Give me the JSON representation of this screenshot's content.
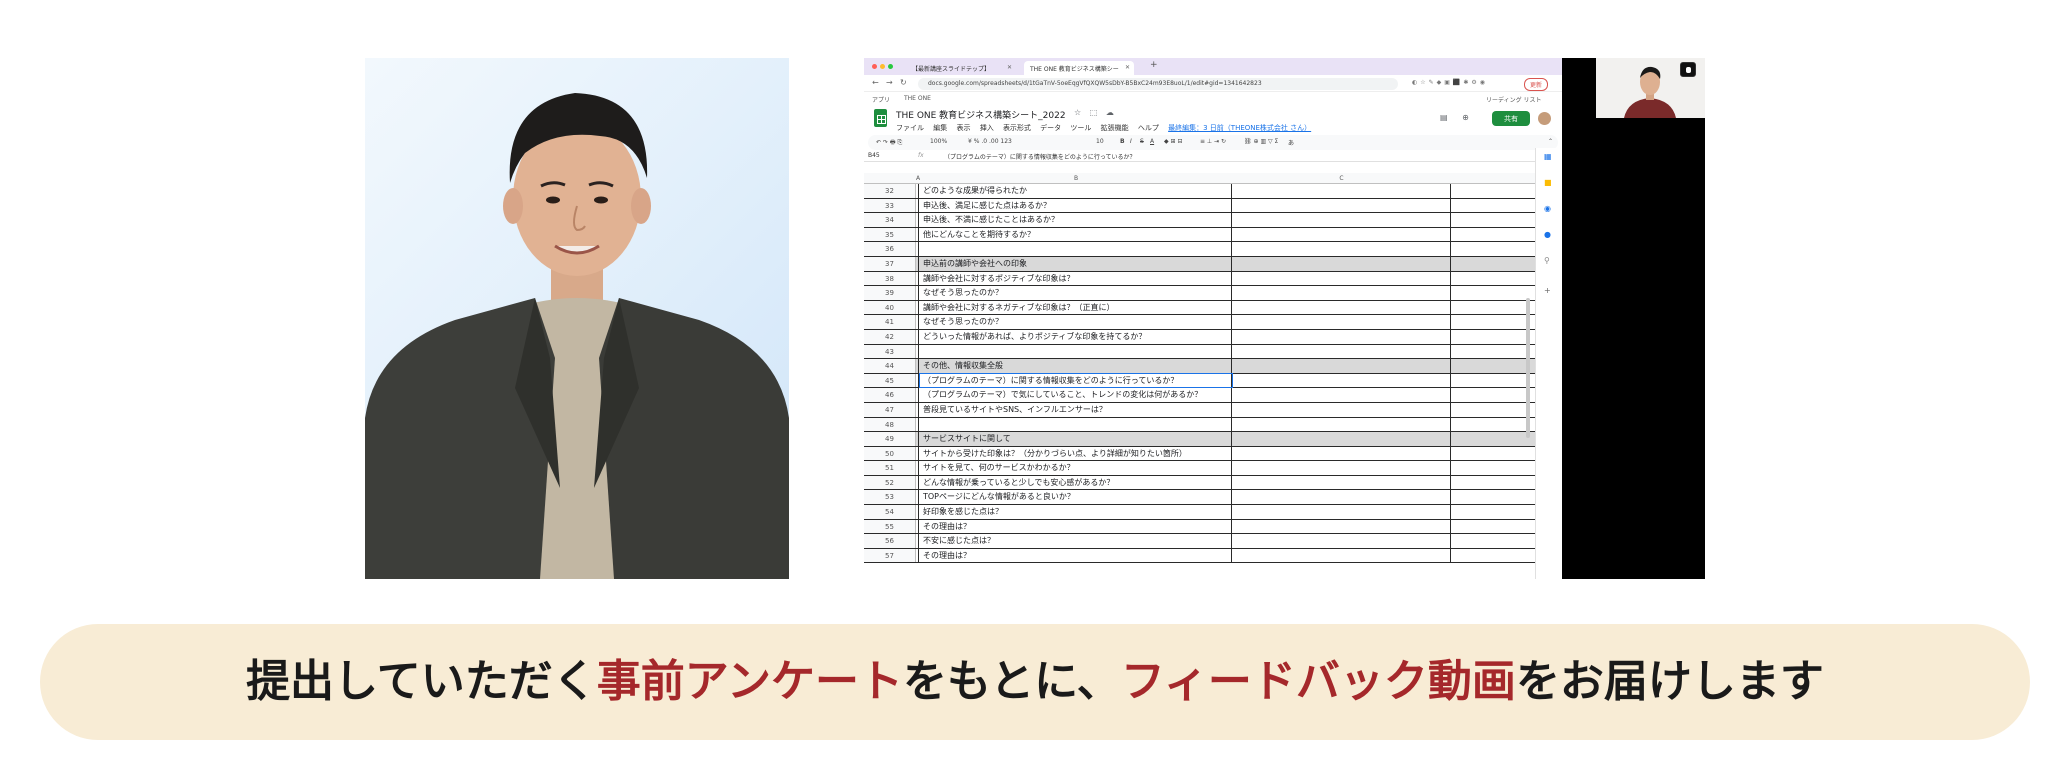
{
  "caption": {
    "part1": "提出していただく",
    "highlight1": "事前アンケート",
    "part2": "をもとに、",
    "highlight2": "フィードバック動画",
    "part3": "をお届けします",
    "highlight_color": "#a5282b",
    "banner_color": "#f8ecd5"
  },
  "browser": {
    "tabs": [
      {
        "label": "【最新講座スライドテップ】",
        "active": false
      },
      {
        "label": "THE ONE 教育ビジネス構築シー",
        "active": true
      }
    ],
    "url": "docs.google.com/spreadsheets/d/1tGaTnV-5oeEqgVfQXQW5sDbY-B5BxC24m93E8uoL/1/edit#gid=1341642823",
    "update_label": "更新",
    "bookmarks": [
      "アプリ",
      "THE ONE"
    ],
    "reading_list": "リーディング リスト"
  },
  "sheet": {
    "title": "THE ONE 教育ビジネス構築シート_2022",
    "menus": [
      "ファイル",
      "編集",
      "表示",
      "挿入",
      "表示形式",
      "データ",
      "ツール",
      "拡張機能",
      "ヘルプ"
    ],
    "last_edit": "最終編集：3 日前（THEONE株式会社 さん）",
    "share_label": "共有",
    "zoom": "100%",
    "font_size": "10",
    "name_box": "B45",
    "formula": "（プログラムのテーマ）に関する情報収集をどのように行っているか？",
    "columns": [
      "A",
      "B",
      "C"
    ],
    "rows": [
      {
        "num": "32",
        "text": "どのような成果が得られたか",
        "section": false
      },
      {
        "num": "33",
        "text": "申込後、満足に感じた点はあるか？",
        "section": false
      },
      {
        "num": "34",
        "text": "申込後、不満に感じたことはあるか？",
        "section": false
      },
      {
        "num": "35",
        "text": "他にどんなことを期待するか？",
        "section": false
      },
      {
        "num": "36",
        "text": "",
        "section": false
      },
      {
        "num": "37",
        "text": "申込前の講師や会社への印象",
        "section": true
      },
      {
        "num": "38",
        "text": "講師や会社に対するポジティブな印象は？",
        "section": false
      },
      {
        "num": "39",
        "text": "なぜそう思ったのか？",
        "section": false
      },
      {
        "num": "40",
        "text": "講師や会社に対するネガティブな印象は？（正直に）",
        "section": false
      },
      {
        "num": "41",
        "text": "なぜそう思ったのか？",
        "section": false
      },
      {
        "num": "42",
        "text": "どういった情報があれば、よりポジティブな印象を持てるか？",
        "section": false
      },
      {
        "num": "43",
        "text": "",
        "section": false
      },
      {
        "num": "44",
        "text": "その他、情報収集全般",
        "section": true
      },
      {
        "num": "45",
        "text": "（プログラムのテーマ）に関する情報収集をどのように行っているか？",
        "section": false
      },
      {
        "num": "46",
        "text": "（プログラムのテーマ）で気にしていること、トレンドの変化は何があるか？",
        "section": false
      },
      {
        "num": "47",
        "text": "普段見ているサイトやSNS、インフルエンサーは？",
        "section": false
      },
      {
        "num": "48",
        "text": "",
        "section": false
      },
      {
        "num": "49",
        "text": "サービスサイトに関して",
        "section": true
      },
      {
        "num": "50",
        "text": "サイトから受けた印象は？（分かりづらい点、より詳細が知りたい箇所）",
        "section": false
      },
      {
        "num": "51",
        "text": "サイトを見て、何のサービスかわかるか？",
        "section": false
      },
      {
        "num": "52",
        "text": "どんな情報が乗っていると少しでも安心感があるか？",
        "section": false
      },
      {
        "num": "53",
        "text": "TOPページにどんな情報があると良いか？",
        "section": false
      },
      {
        "num": "54",
        "text": "好印象を感じた点は？",
        "section": false
      },
      {
        "num": "55",
        "text": "その理由は？",
        "section": false
      },
      {
        "num": "56",
        "text": "不安に感じた点は？",
        "section": false
      },
      {
        "num": "57",
        "text": "その理由は？",
        "section": false
      }
    ]
  }
}
